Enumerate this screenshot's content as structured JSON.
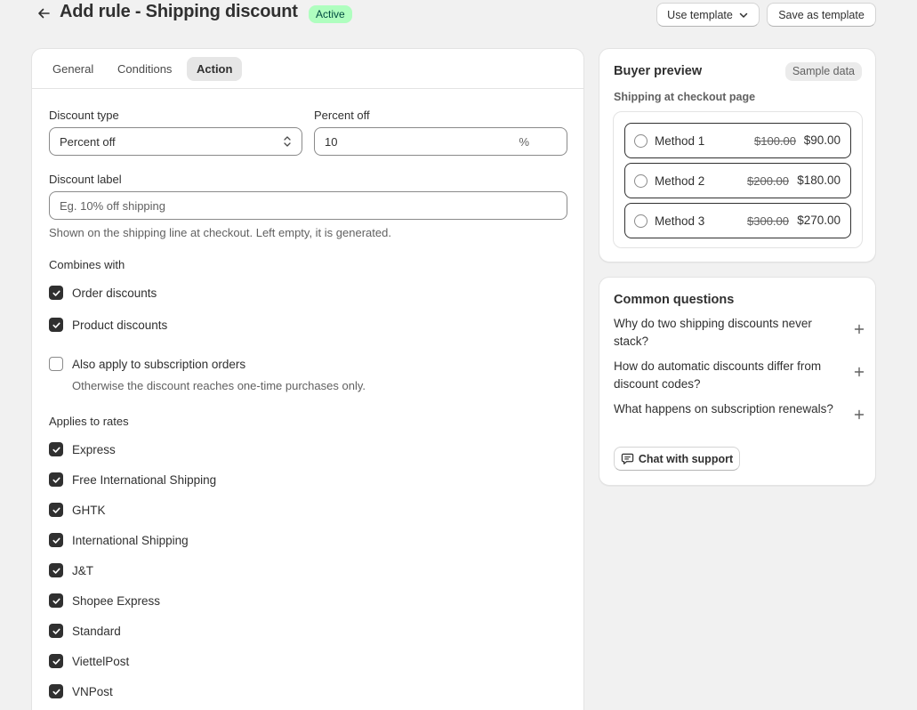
{
  "header": {
    "title": "Add rule - Shipping discount",
    "status": "Active",
    "use_template_label": "Use template",
    "save_template_label": "Save as template"
  },
  "tabs": [
    {
      "label": "General"
    },
    {
      "label": "Conditions"
    },
    {
      "label": "Action",
      "active": true
    }
  ],
  "form": {
    "discount_type_label": "Discount type",
    "discount_type_value": "Percent off",
    "percent_off_label": "Percent off",
    "percent_off_value": "10",
    "percent_suffix": "%",
    "discount_label_label": "Discount label",
    "discount_label_placeholder": "Eg. 10% off shipping",
    "discount_label_help": "Shown on the shipping line at checkout. Left empty, it is generated.",
    "combines_label": "Combines with",
    "combines": [
      {
        "label": "Order discounts",
        "checked": true
      },
      {
        "label": "Product discounts",
        "checked": true
      }
    ],
    "subscription_label": "Also apply to subscription orders",
    "subscription_checked": false,
    "subscription_help": "Otherwise the discount reaches one-time purchases only.",
    "rates_label": "Applies to rates",
    "rates": [
      {
        "label": "Express",
        "checked": true
      },
      {
        "label": "Free International Shipping",
        "checked": true
      },
      {
        "label": "GHTK",
        "checked": true
      },
      {
        "label": "International Shipping",
        "checked": true
      },
      {
        "label": "J&T",
        "checked": true
      },
      {
        "label": "Shopee Express",
        "checked": true
      },
      {
        "label": "Standard",
        "checked": true
      },
      {
        "label": "ViettelPost",
        "checked": true
      },
      {
        "label": "VNPost",
        "checked": true
      }
    ]
  },
  "preview": {
    "title": "Buyer preview",
    "badge": "Sample data",
    "subheading": "Shipping at checkout page",
    "methods": [
      {
        "name": "Method 1",
        "old_price": "$100.00",
        "new_price": "$90.00"
      },
      {
        "name": "Method 2",
        "old_price": "$200.00",
        "new_price": "$180.00"
      },
      {
        "name": "Method 3",
        "old_price": "$300.00",
        "new_price": "$270.00"
      }
    ]
  },
  "faq": {
    "title": "Common questions",
    "questions": [
      "Why do two shipping discounts never stack?",
      "How do automatic discounts differ from discount codes?",
      "What happens on subscription renewals?"
    ],
    "chat_label": "Chat with support"
  },
  "colors": {
    "background": "#f1f1f1",
    "card": "#ffffff",
    "text": "#303030",
    "subdued": "#616161",
    "badge_success_bg": "#affebf",
    "badge_success_text": "#014b40",
    "checkbox_checked": "#303030"
  },
  "icons": {
    "back": "arrow-left-icon",
    "chevron": "chevron-down-icon",
    "select": "select-chevrons-icon",
    "plus": "plus-icon",
    "chat": "chat-bubble-icon",
    "check": "checkmark-icon"
  }
}
